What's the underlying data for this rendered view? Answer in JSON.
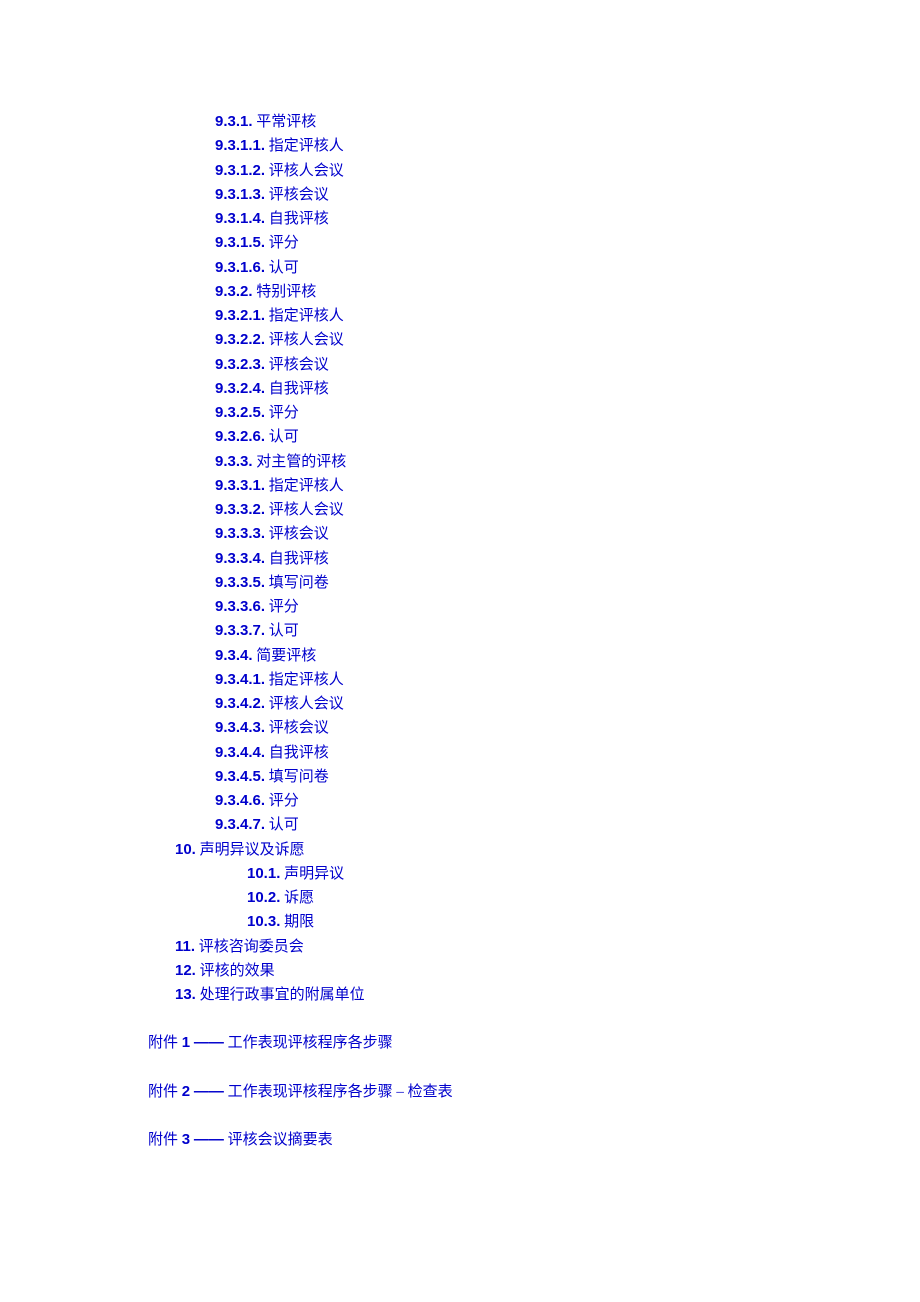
{
  "toc": [
    {
      "indent": 2,
      "num": "9.3.1.",
      "text": "平常评核"
    },
    {
      "indent": 2,
      "num": "9.3.1.1.",
      "text": "指定评核人"
    },
    {
      "indent": 2,
      "num": "9.3.1.2.",
      "text": "评核人会议"
    },
    {
      "indent": 2,
      "num": "9.3.1.3.",
      "text": "评核会议"
    },
    {
      "indent": 2,
      "num": "9.3.1.4.",
      "text": "自我评核"
    },
    {
      "indent": 2,
      "num": "9.3.1.5.",
      "text": "评分"
    },
    {
      "indent": 2,
      "num": "9.3.1.6.",
      "text": "认可"
    },
    {
      "indent": 2,
      "num": "9.3.2.",
      "text": "特别评核"
    },
    {
      "indent": 2,
      "num": "9.3.2.1.",
      "text": "指定评核人"
    },
    {
      "indent": 2,
      "num": "9.3.2.2.",
      "text": "评核人会议"
    },
    {
      "indent": 2,
      "num": "9.3.2.3.",
      "text": "评核会议"
    },
    {
      "indent": 2,
      "num": "9.3.2.4.",
      "text": "自我评核"
    },
    {
      "indent": 2,
      "num": "9.3.2.5.",
      "text": "评分"
    },
    {
      "indent": 2,
      "num": "9.3.2.6.",
      "text": "认可"
    },
    {
      "indent": 2,
      "num": "9.3.3.",
      "text": "对主管的评核"
    },
    {
      "indent": 2,
      "num": "9.3.3.1.",
      "text": "指定评核人"
    },
    {
      "indent": 2,
      "num": "9.3.3.2.",
      "text": "评核人会议"
    },
    {
      "indent": 2,
      "num": "9.3.3.3.",
      "text": "评核会议"
    },
    {
      "indent": 2,
      "num": "9.3.3.4.",
      "text": "自我评核"
    },
    {
      "indent": 2,
      "num": "9.3.3.5.",
      "text": "填写问卷"
    },
    {
      "indent": 2,
      "num": "9.3.3.6.",
      "text": "评分"
    },
    {
      "indent": 2,
      "num": "9.3.3.7.",
      "text": "认可"
    },
    {
      "indent": 2,
      "num": "9.3.4.",
      "text": "简要评核"
    },
    {
      "indent": 2,
      "num": "9.3.4.1.",
      "text": "指定评核人"
    },
    {
      "indent": 2,
      "num": "9.3.4.2.",
      "text": "评核人会议"
    },
    {
      "indent": 2,
      "num": "9.3.4.3.",
      "text": "评核会议"
    },
    {
      "indent": 2,
      "num": "9.3.4.4.",
      "text": "自我评核"
    },
    {
      "indent": 2,
      "num": "9.3.4.5.",
      "text": "填写问卷"
    },
    {
      "indent": 2,
      "num": "9.3.4.6.",
      "text": "评分"
    },
    {
      "indent": 2,
      "num": "9.3.4.7.",
      "text": "认可"
    },
    {
      "indent": 0,
      "num": "10.",
      "text": "声明异议及诉愿",
      "top": true
    },
    {
      "indent": 1,
      "num": "10.1.",
      "text": "声明异议"
    },
    {
      "indent": 1,
      "num": "10.2.",
      "text": "诉愿"
    },
    {
      "indent": 1,
      "num": "10.3.",
      "text": "期限"
    },
    {
      "indent": 0,
      "num": "11.",
      "text": "评核咨询委员会",
      "top": true
    },
    {
      "indent": 0,
      "num": "12.",
      "text": "评核的效果",
      "top": true
    },
    {
      "indent": 0,
      "num": "13.",
      "text": "处理行政事宜的附属单位",
      "top": true
    }
  ],
  "appendix": [
    {
      "label": "附件",
      "num": "1",
      "dash": "——",
      "text": "工作表现评核程序各步骤"
    },
    {
      "label": "附件",
      "num": "2",
      "dash": "——",
      "text": "工作表现评核程序各步骤  – 检查表"
    },
    {
      "label": "附件",
      "num": "3",
      "dash": "——",
      "text": "评核会议摘要表"
    }
  ]
}
